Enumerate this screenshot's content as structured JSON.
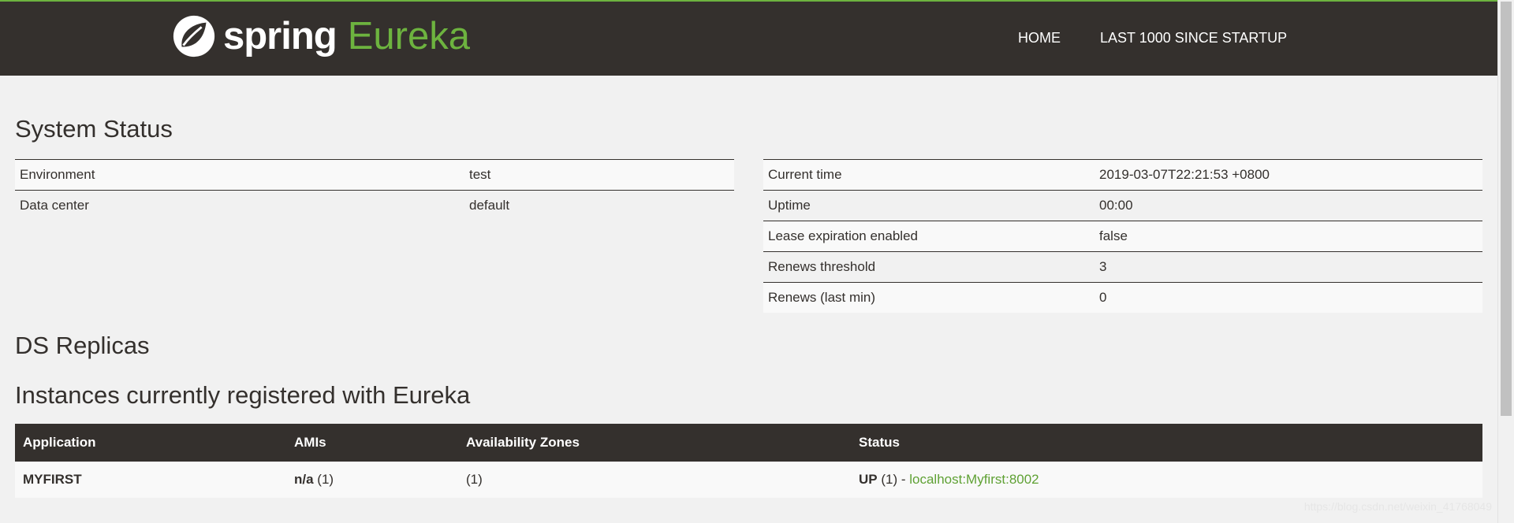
{
  "navbar": {
    "brand_spring": "spring",
    "brand_eureka": "Eureka",
    "links": [
      "HOME",
      "LAST 1000 SINCE STARTUP"
    ],
    "logo_icon": "spring-leaf-icon",
    "background": "#34302d",
    "accent": "#6db33f"
  },
  "system_status": {
    "heading": "System Status",
    "left": [
      {
        "label": "Environment",
        "value": "test"
      },
      {
        "label": "Data center",
        "value": "default"
      }
    ],
    "right": [
      {
        "label": "Current time",
        "value": "2019-03-07T22:21:53 +0800"
      },
      {
        "label": "Uptime",
        "value": "00:00"
      },
      {
        "label": "Lease expiration enabled",
        "value": "false"
      },
      {
        "label": "Renews threshold",
        "value": "3"
      },
      {
        "label": "Renews (last min)",
        "value": "0"
      }
    ]
  },
  "replicas": {
    "heading": "DS Replicas"
  },
  "instances": {
    "heading": "Instances currently registered with Eureka",
    "columns": [
      "Application",
      "AMIs",
      "Availability Zones",
      "Status"
    ],
    "rows": [
      {
        "application": "MYFIRST",
        "ami_name": "n/a",
        "ami_count": " (1)",
        "zones": "(1)",
        "status": "UP",
        "status_count": " (1) - ",
        "instance_link": "localhost:Myfirst:8002"
      }
    ]
  },
  "watermark": "https://blog.csdn.net/weixin_41768049"
}
